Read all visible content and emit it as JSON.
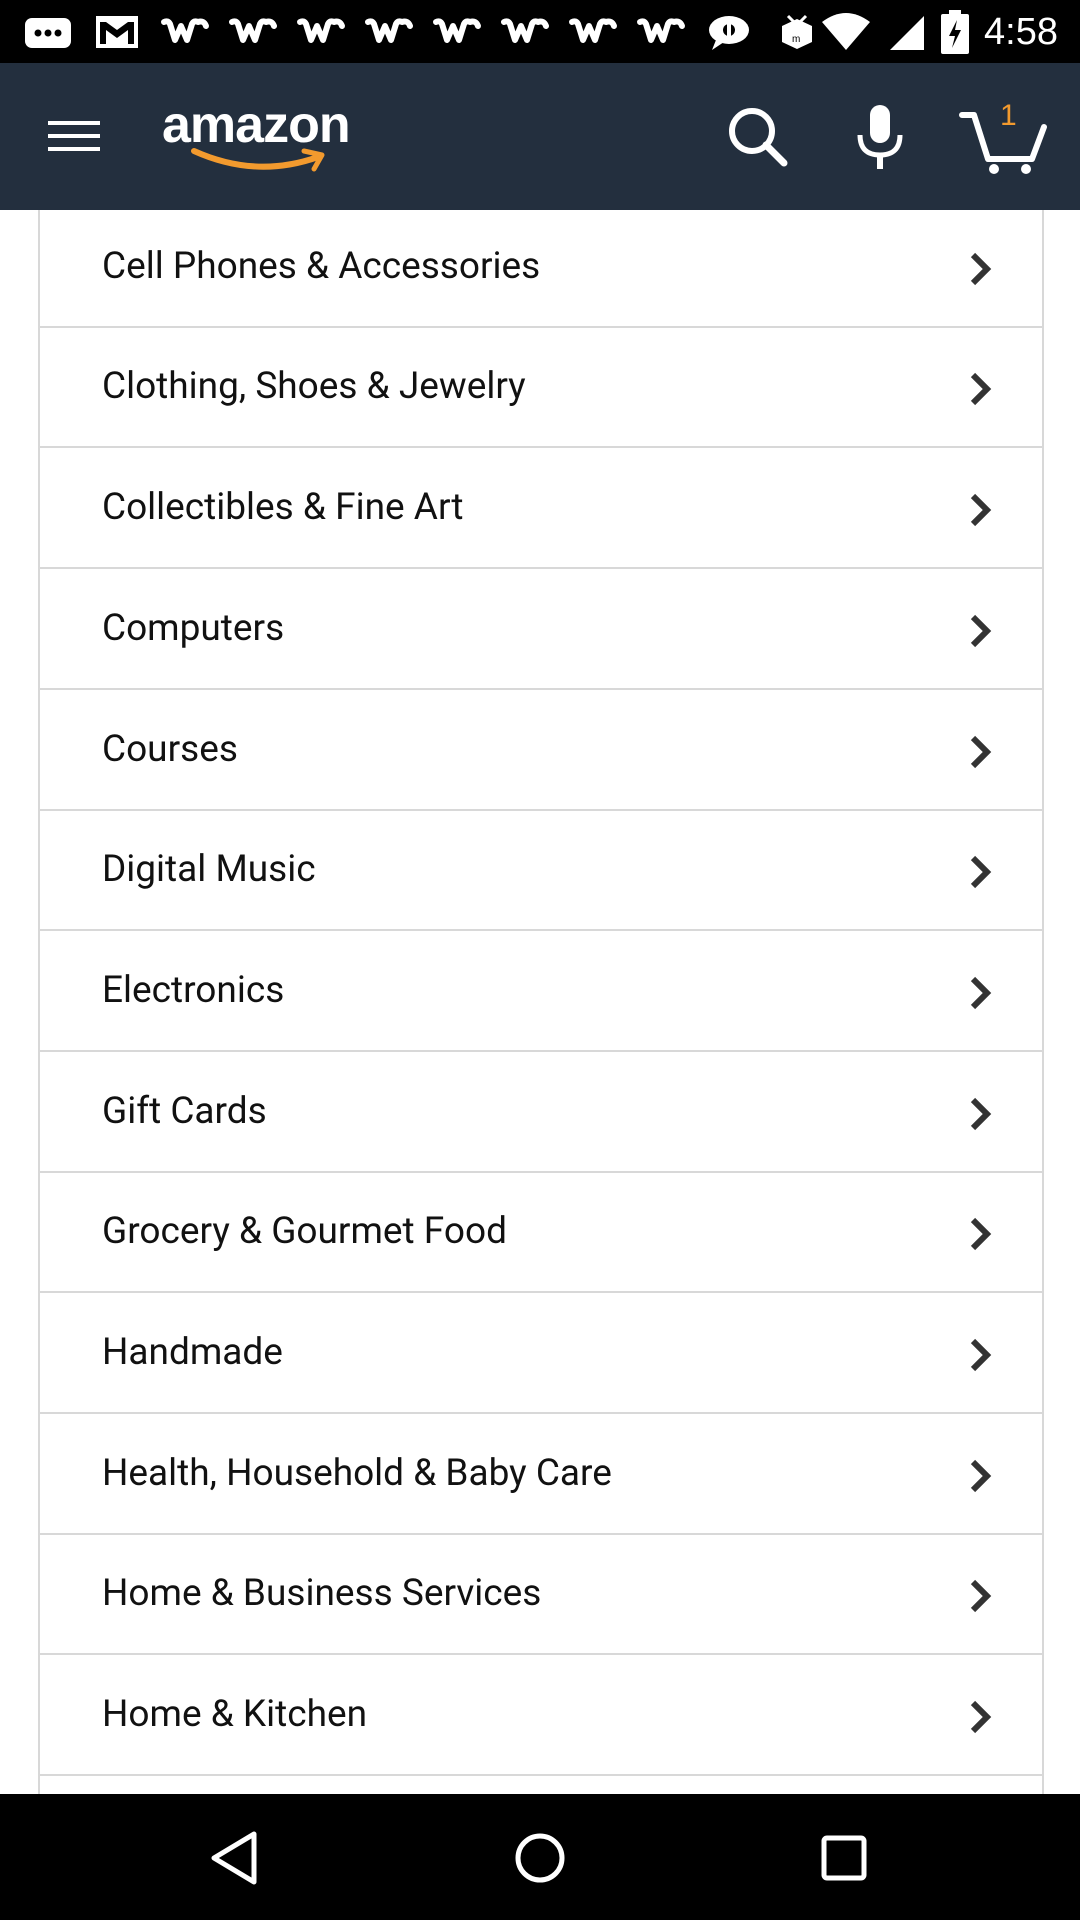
{
  "status_bar": {
    "time": "4:58",
    "notification_icons": [
      "message-icon",
      "gmail-icon",
      "w-icon",
      "w-icon",
      "w-icon",
      "w-icon",
      "w-icon",
      "w-icon",
      "w-icon",
      "w-icon",
      "chat-icon",
      "box-icon"
    ],
    "system_icons": [
      "wifi-icon",
      "signal-icon",
      "battery-charging-icon"
    ]
  },
  "header": {
    "logo_text": "amazon",
    "cart_count": "1",
    "colors": {
      "background": "#232F3E",
      "accent": "#F29A2E"
    }
  },
  "categories": [
    {
      "label": "Cell Phones & Accessories"
    },
    {
      "label": "Clothing, Shoes & Jewelry"
    },
    {
      "label": "Collectibles & Fine Art"
    },
    {
      "label": "Computers"
    },
    {
      "label": "Courses"
    },
    {
      "label": "Digital Music"
    },
    {
      "label": "Electronics"
    },
    {
      "label": "Gift Cards"
    },
    {
      "label": "Grocery & Gourmet Food"
    },
    {
      "label": "Handmade"
    },
    {
      "label": "Health, Household & Baby Care"
    },
    {
      "label": "Home & Business Services"
    },
    {
      "label": "Home & Kitchen"
    }
  ],
  "nav_bar": {
    "buttons": [
      "back-icon",
      "home-icon",
      "recents-icon"
    ]
  }
}
